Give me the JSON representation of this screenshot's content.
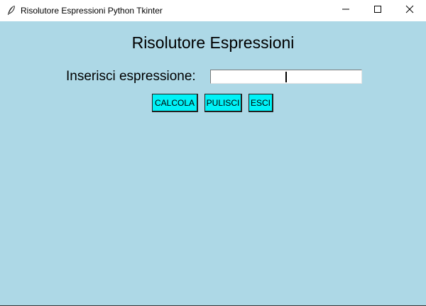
{
  "window": {
    "title": "Risolutore Espressioni Python Tkinter",
    "icon": "feather-icon",
    "controls": {
      "minimize": "minimize-icon",
      "maximize": "maximize-icon",
      "close": "close-icon"
    }
  },
  "main": {
    "heading": "Risolutore Espressioni",
    "expression_label": "Inserisci espressione:",
    "expression_value": "",
    "background_color": "#add8e6"
  },
  "buttons": {
    "calcola": "CALCOLA",
    "pulisci": "PULISCI",
    "esci": "ESCI",
    "color": "#00f2f7"
  }
}
